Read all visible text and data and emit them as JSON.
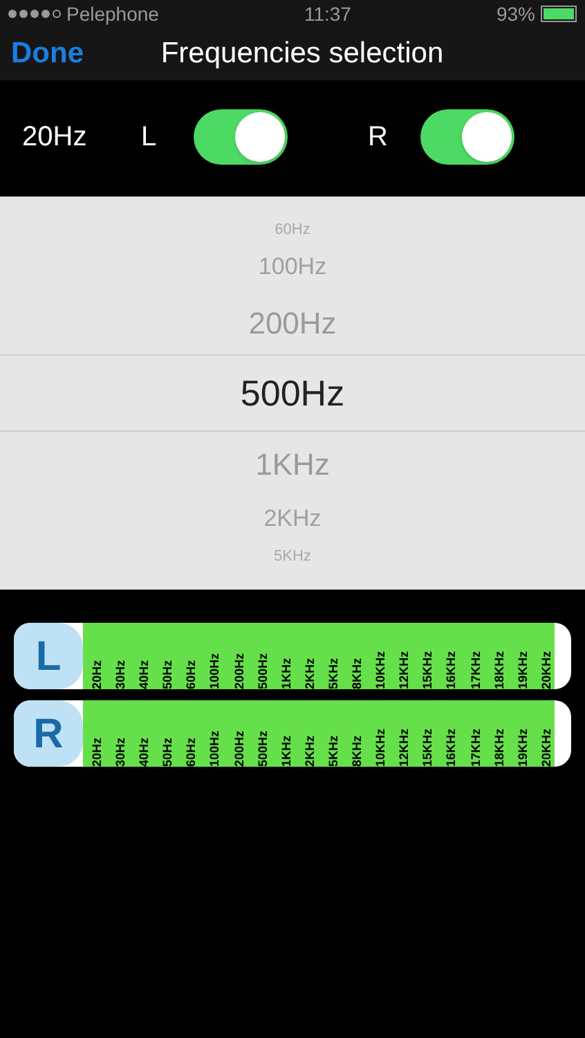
{
  "status_bar": {
    "carrier": "Pelephone",
    "time": "11:37",
    "battery": "93%"
  },
  "nav": {
    "back": "Done",
    "title": "Frequencies selection"
  },
  "current_frequency": "20Hz",
  "toggles": [
    {
      "label": "L",
      "on": true
    },
    {
      "label": "R",
      "on": true
    }
  ],
  "picker": [
    {
      "label": "60Hz",
      "selected": false
    },
    {
      "label": "100Hz",
      "selected": false
    },
    {
      "label": "200Hz",
      "selected": false
    },
    {
      "label": "500Hz",
      "selected": true
    },
    {
      "label": "1KHz",
      "selected": false
    },
    {
      "label": "2KHz",
      "selected": false
    },
    {
      "label": "5KHz",
      "selected": false
    }
  ],
  "channels": [
    {
      "label": "L",
      "frequencies": [
        "20Hz",
        "30Hz",
        "40Hz",
        "50Hz",
        "60Hz",
        "100Hz",
        "200Hz",
        "500Hz",
        "1KHz",
        "2KHz",
        "5KHz",
        "8KHz",
        "10KHz",
        "12KHz",
        "15KHz",
        "16KHz",
        "17KHz",
        "18KHz",
        "19KHz",
        "20KHz"
      ]
    },
    {
      "label": "R",
      "frequencies": [
        "20Hz",
        "30Hz",
        "40Hz",
        "50Hz",
        "60Hz",
        "100Hz",
        "200Hz",
        "500Hz",
        "1KHz",
        "2KHz",
        "5KHz",
        "8KHz",
        "10KHz",
        "12KHz",
        "15KHz",
        "16KHz",
        "17KHz",
        "18KHz",
        "19KHz",
        "20KHz"
      ]
    }
  ]
}
